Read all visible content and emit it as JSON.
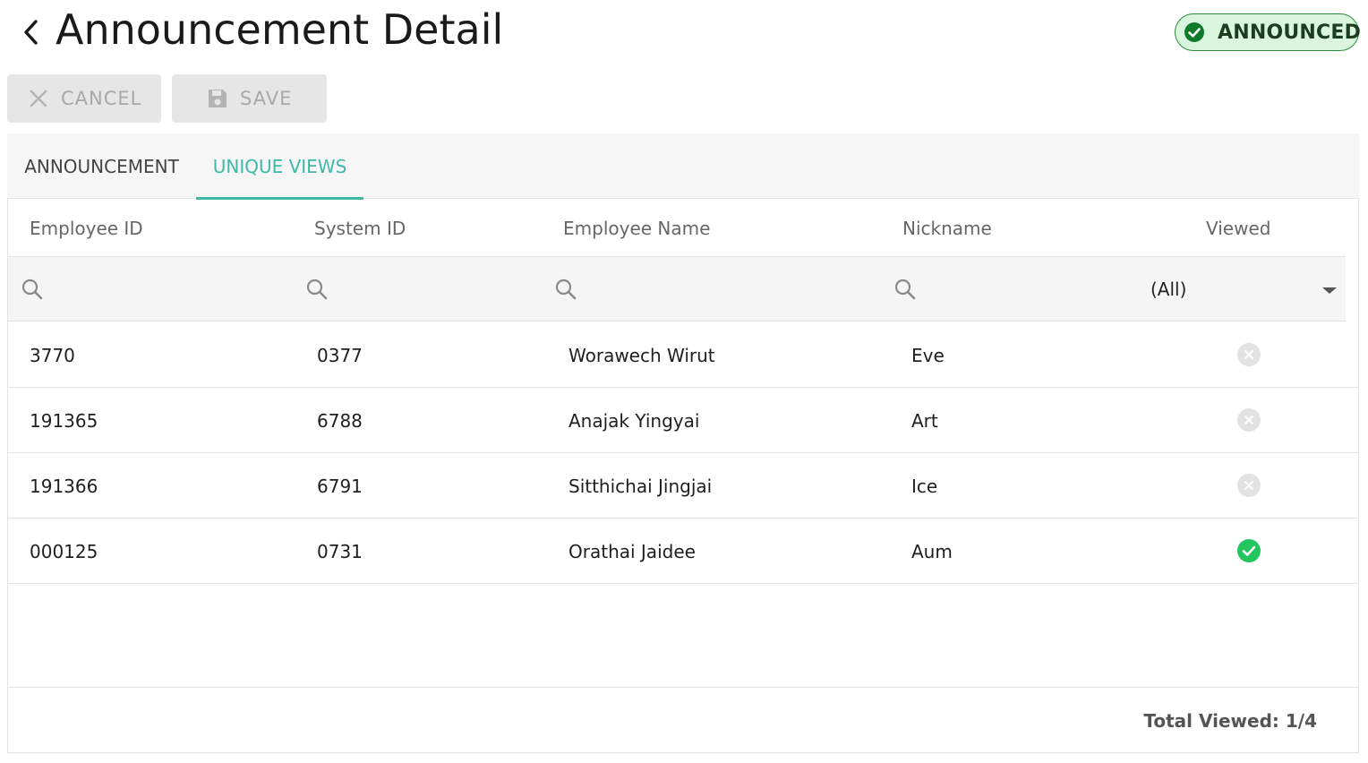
{
  "header": {
    "title": "Announcement Detail",
    "status": "ANNOUNCED",
    "status_color": "#2e8b3e",
    "status_icon": "check-circle-icon"
  },
  "toolbar": {
    "cancel_label": "CANCEL",
    "save_label": "SAVE",
    "cancel_icon": "close-icon",
    "save_icon": "floppy-disk-icon"
  },
  "tabs": [
    {
      "label": "ANNOUNCEMENT",
      "active": false
    },
    {
      "label": "UNIQUE VIEWS",
      "active": true
    }
  ],
  "accent_color": "#3fb8a7",
  "grid": {
    "columns": [
      "Employee ID",
      "System ID",
      "Employee Name",
      "Nickname",
      "Viewed"
    ],
    "filters": {
      "employee_id": "",
      "system_id": "",
      "employee_name": "",
      "nickname": "",
      "viewed": "(All)"
    },
    "rows": [
      {
        "employee_id": "3770",
        "system_id": "0377",
        "employee_name": "Worawech Wirut",
        "nickname": "Eve",
        "viewed": false
      },
      {
        "employee_id": "191365",
        "system_id": "6788",
        "employee_name": "Anajak Yingyai",
        "nickname": "Art",
        "viewed": false
      },
      {
        "employee_id": "191366",
        "system_id": "6791",
        "employee_name": "Sitthichai Jingjai",
        "nickname": "Ice",
        "viewed": false
      },
      {
        "employee_id": "000125",
        "system_id": "0731",
        "employee_name": "Orathai Jaidee",
        "nickname": "Aum",
        "viewed": true
      }
    ],
    "viewed_yes_color": "#22c55e",
    "viewed_no_color": "#e0e0e0"
  },
  "footer": {
    "total_viewed": "Total Viewed: 1/4"
  }
}
